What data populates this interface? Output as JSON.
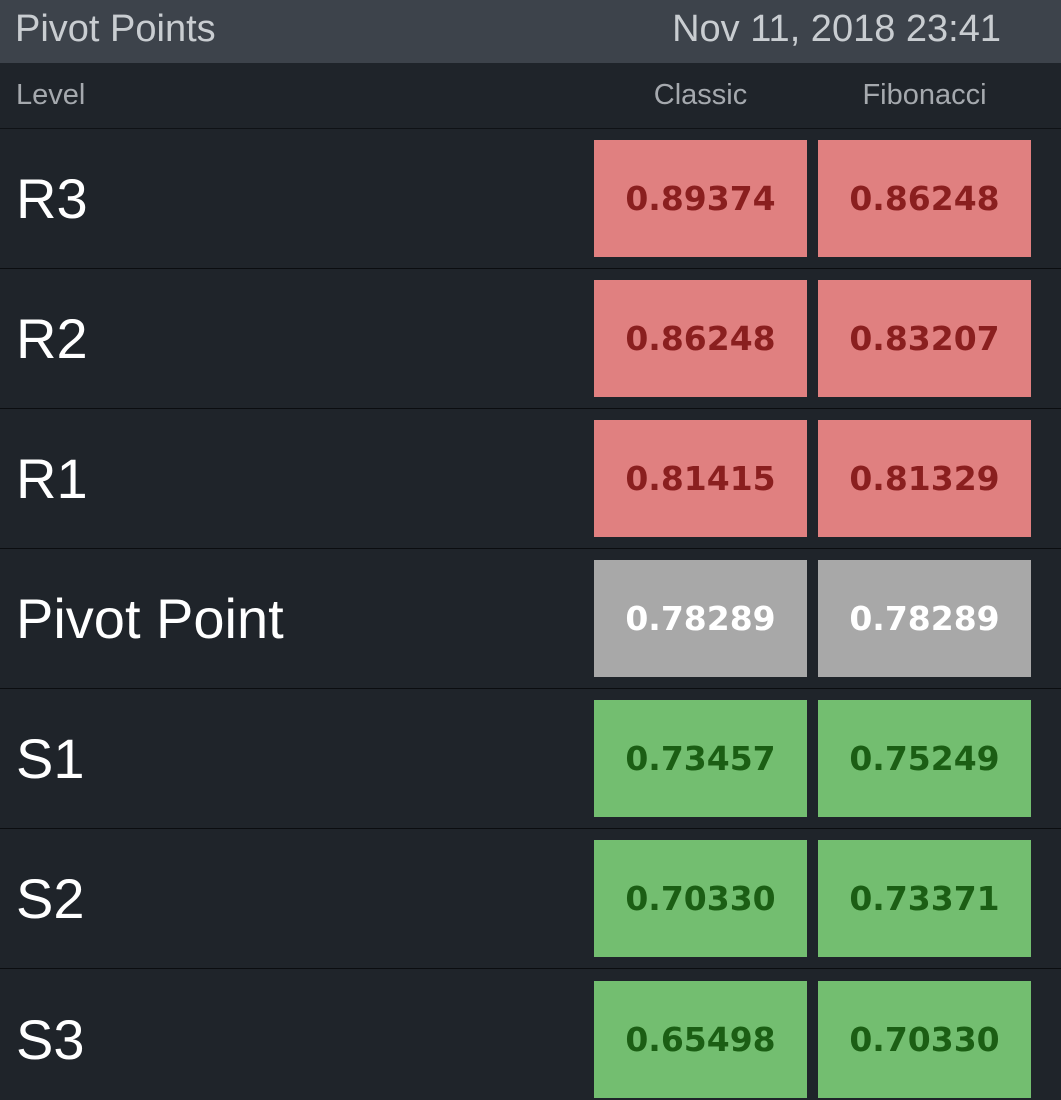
{
  "header": {
    "title": "Pivot Points",
    "datetime": "Nov 11, 2018 23:41"
  },
  "columns": {
    "level": "Level",
    "classic": "Classic",
    "fibonacci": "Fibonacci"
  },
  "rows": [
    {
      "level": "R3",
      "classic": "0.89374",
      "fibonacci": "0.86248",
      "kind": "resistance"
    },
    {
      "level": "R2",
      "classic": "0.86248",
      "fibonacci": "0.83207",
      "kind": "resistance"
    },
    {
      "level": "R1",
      "classic": "0.81415",
      "fibonacci": "0.81329",
      "kind": "resistance"
    },
    {
      "level": "Pivot Point",
      "classic": "0.78289",
      "fibonacci": "0.78289",
      "kind": "pivot"
    },
    {
      "level": "S1",
      "classic": "0.73457",
      "fibonacci": "0.75249",
      "kind": "support"
    },
    {
      "level": "S2",
      "classic": "0.70330",
      "fibonacci": "0.73371",
      "kind": "support"
    },
    {
      "level": "S3",
      "classic": "0.65498",
      "fibonacci": "0.70330",
      "kind": "support"
    }
  ],
  "colors": {
    "resistance_bg": "#e08080",
    "resistance_text": "#8a1f1f",
    "pivot_bg": "#a8a8a8",
    "pivot_text": "#ffffff",
    "support_bg": "#73be70",
    "support_text": "#1b5e14"
  }
}
